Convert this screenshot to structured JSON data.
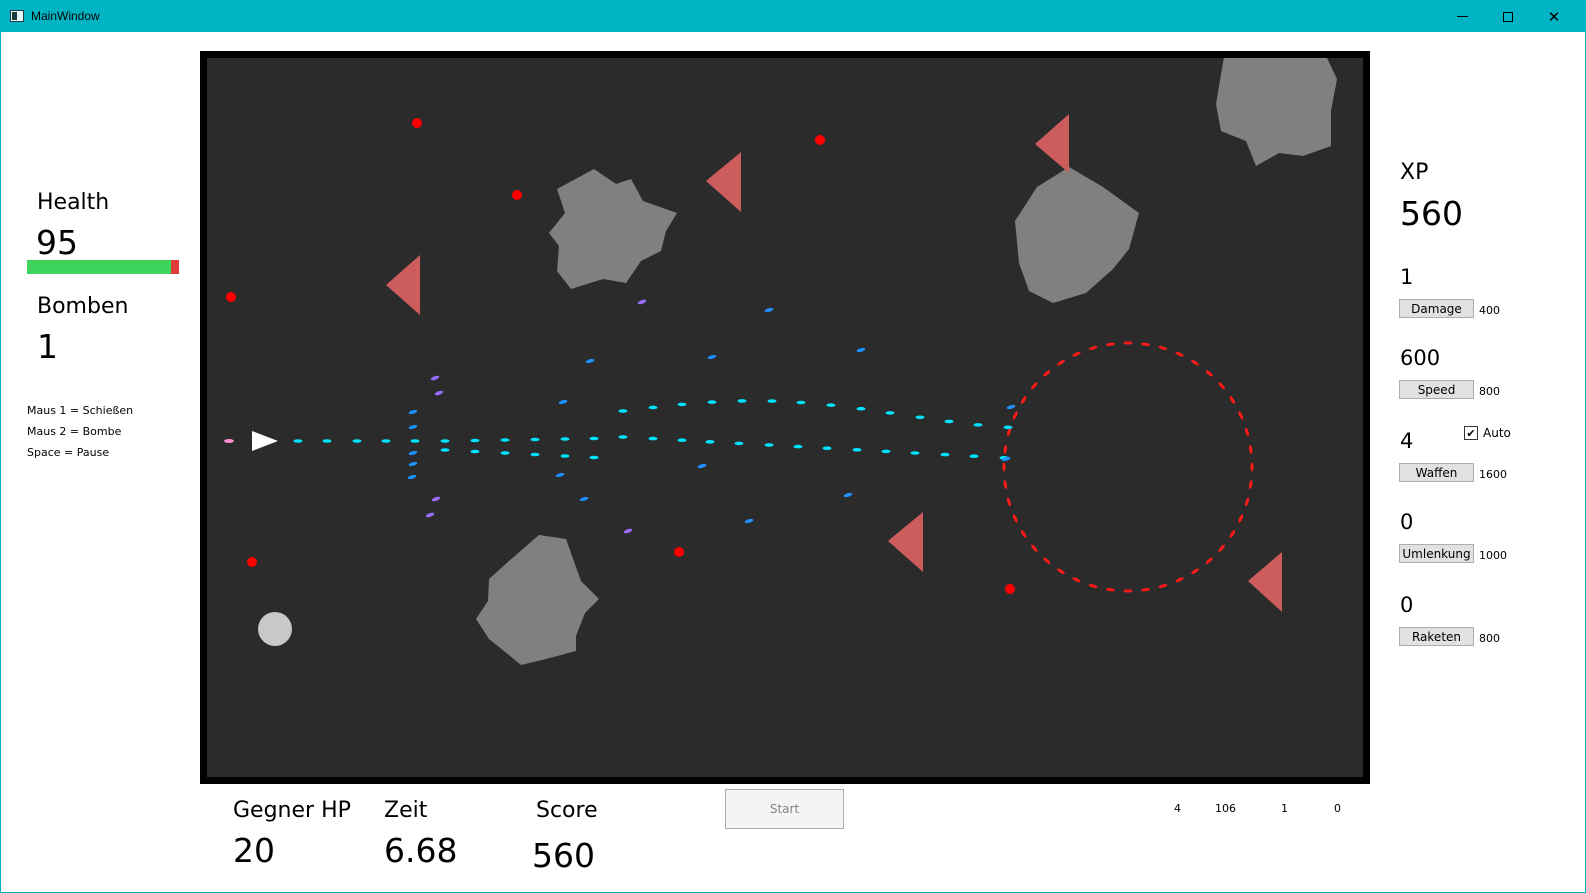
{
  "window": {
    "title": "MainWindow"
  },
  "left_panel": {
    "health_label": "Health",
    "health_value": "95",
    "health_fraction": 0.95,
    "bombs_label": "Bomben",
    "bombs_value": "1",
    "controls": [
      "Maus 1 = Schießen",
      "Maus 2 = Bombe",
      "Space = Pause"
    ]
  },
  "bottom_bar": {
    "enemy_hp_label": "Gegner HP",
    "enemy_hp_value": "20",
    "time_label": "Zeit",
    "time_value": "6.68",
    "score_label": "Score",
    "score_value": "560",
    "start_button": "Start",
    "debug_values": [
      "4",
      "106",
      "1",
      "0"
    ]
  },
  "right_panel": {
    "xp_label": "XP",
    "xp_value": "560",
    "upgrades": [
      {
        "level": "1",
        "button": "Damage",
        "cost": "400"
      },
      {
        "level": "600",
        "button": "Speed",
        "cost": "800"
      },
      {
        "level": "4",
        "button": "Waffen",
        "cost": "1600"
      },
      {
        "level": "0",
        "button": "Umlenkung",
        "cost": "1000"
      },
      {
        "level": "0",
        "button": "Raketen",
        "cost": "800"
      }
    ],
    "auto_label": "Auto",
    "auto_checked": true
  },
  "colors": {
    "titlebar": "#00b4c4",
    "game_background": "#2b2b2b",
    "asteroid": "#808080",
    "enemy_triangle": "#cd5c5c",
    "enemy_bullet": "#ff0000",
    "player_bullet": "#00e5ff",
    "health_bar": "#3ed35a"
  }
}
